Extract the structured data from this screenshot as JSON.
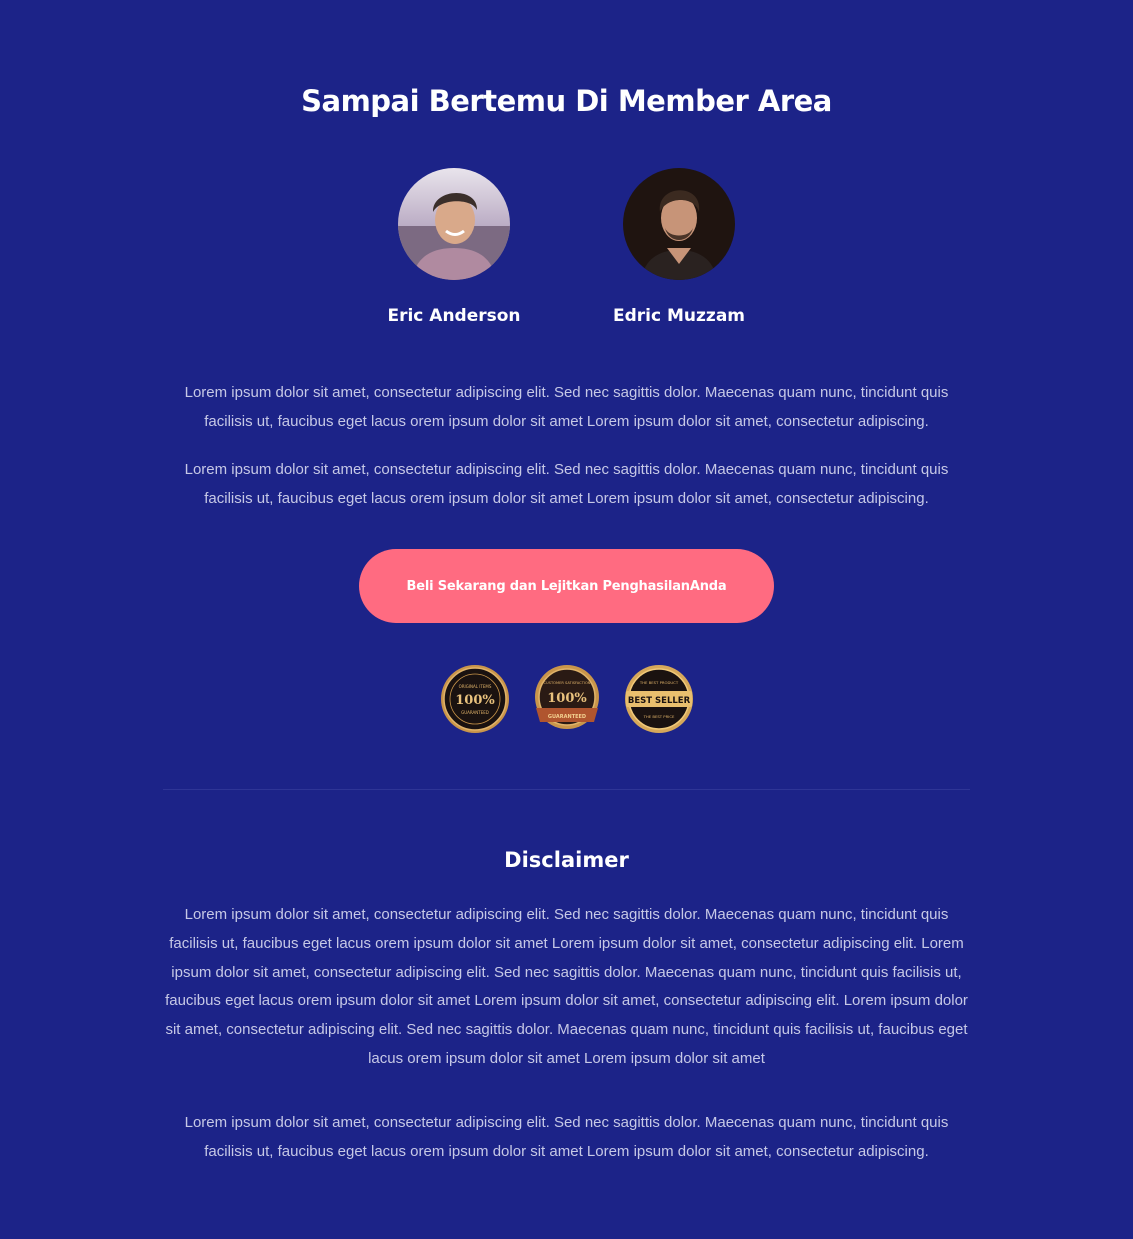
{
  "header": {
    "title": "Sampai Bertemu Di Member Area"
  },
  "team": [
    {
      "name": "Eric Anderson"
    },
    {
      "name": "Edric Muzzam"
    }
  ],
  "intro": {
    "paragraph_1": "Lorem ipsum dolor sit amet, consectetur adipiscing elit. Sed nec sagittis dolor. Maecenas quam nunc, tincidunt quis facilisis ut, faucibus eget lacus orem ipsum dolor sit amet Lorem ipsum dolor sit amet, consectetur adipiscing.",
    "paragraph_2": "Lorem ipsum dolor sit amet, consectetur adipiscing elit. Sed nec sagittis dolor. Maecenas quam nunc, tincidunt quis facilisis ut, faucibus eget lacus orem ipsum dolor sit amet Lorem ipsum dolor sit amet, consectetur adipiscing."
  },
  "cta": {
    "label": "Beli Sekarang dan Lejitkan PenghasilanAnda"
  },
  "badges": [
    {
      "icon": "original-items-seal-icon",
      "big": "100%",
      "top": "ORIGINAL ITEMS",
      "bottom": "GUARANTEED"
    },
    {
      "icon": "satisfaction-guaranteed-seal-icon",
      "big": "100%",
      "top": "CUSTOMER SATISFACTION",
      "bottom": "GUARANTEED"
    },
    {
      "icon": "best-seller-seal-icon",
      "big": "BEST SELLER",
      "top": "THE BEST PRODUCT",
      "bottom": "THE BEST PRICE"
    }
  ],
  "disclaimer": {
    "title": "Disclaimer",
    "paragraph_1": "Lorem ipsum dolor sit amet, consectetur adipiscing elit. Sed nec sagittis dolor. Maecenas quam nunc, tincidunt quis facilisis ut, faucibus eget lacus orem ipsum dolor sit amet Lorem ipsum dolor sit amet, consectetur adipiscing elit. Lorem ipsum dolor sit amet, consectetur adipiscing elit. Sed nec sagittis dolor. Maecenas quam nunc, tincidunt quis facilisis ut, faucibus eget lacus orem ipsum dolor sit amet Lorem ipsum dolor sit amet, consectetur adipiscing elit. Lorem ipsum dolor sit amet, consectetur adipiscing elit. Sed nec sagittis dolor. Maecenas quam nunc, tincidunt quis facilisis ut, faucibus eget lacus orem ipsum dolor sit amet Lorem ipsum dolor sit amet",
    "paragraph_2": "Lorem ipsum dolor sit amet, consectetur adipiscing elit. Sed nec sagittis dolor. Maecenas quam nunc, tincidunt quis facilisis ut, faucibus eget lacus orem ipsum dolor sit amet Lorem ipsum dolor sit amet, consectetur adipiscing."
  },
  "colors": {
    "background": "#1c2388",
    "cta": "#ff6b81",
    "text_muted": "#c6c8e6",
    "badge_gold": "#c9954a"
  }
}
